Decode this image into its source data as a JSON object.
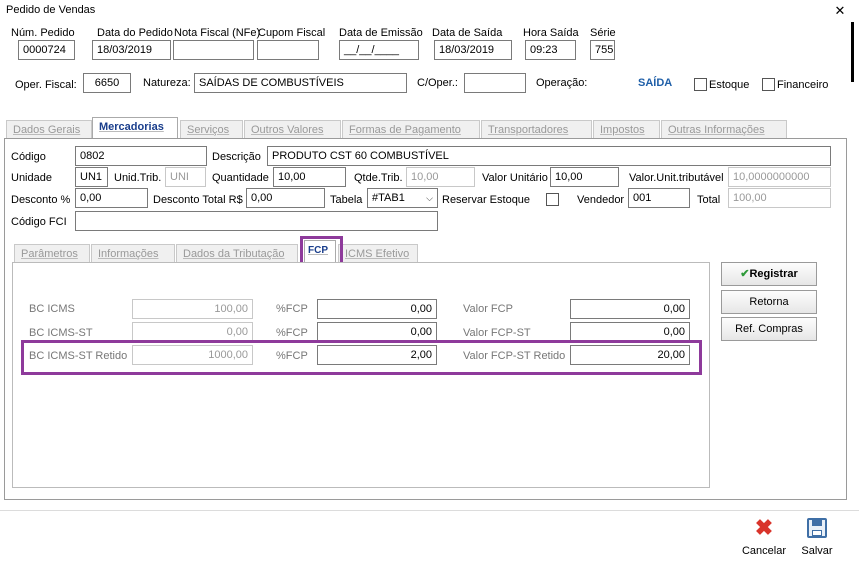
{
  "window": {
    "title": "Pedido de Vendas",
    "close_icon": "close-icon"
  },
  "header": {
    "num_pedido_label": "Núm. Pedido",
    "num_pedido": "0000724",
    "data_pedido_label": "Data do Pedido",
    "data_pedido": "18/03/2019",
    "nota_fiscal_label": "Nota Fiscal (NFe)",
    "nota_fiscal": "",
    "cupom_fiscal_label": "Cupom Fiscal",
    "cupom_fiscal": "",
    "data_emissao_label": "Data de Emissão",
    "data_emissao": "__/__/____",
    "data_saida_label": "Data de Saída",
    "data_saida": "18/03/2019",
    "hora_saida_label": "Hora Saída",
    "hora_saida": "09:23",
    "serie_label": "Série",
    "serie": "755",
    "oper_fiscal_label": "Oper. Fiscal:",
    "oper_fiscal": "6650",
    "natureza_label": "Natureza:",
    "natureza": "SAÍDAS DE COMBUSTÍVEIS",
    "c_oper_label": "C/Oper.:",
    "c_oper": "",
    "operacao_label": "Operação:",
    "operacao": "SAÍDA",
    "estoque_label": "Estoque",
    "financeiro_label": "Financeiro"
  },
  "main_tabs": [
    "Dados Gerais",
    "Mercadorias",
    "Serviços",
    "Outros Valores",
    "Formas de Pagamento",
    "Transportadores",
    "Impostos",
    "Outras Informações"
  ],
  "mercadorias": {
    "codigo_label": "Código",
    "codigo": "0802",
    "descricao_label": "Descrição",
    "descricao": "PRODUTO CST 60 COMBUSTÍVEL",
    "unidade_label": "Unidade",
    "unidade": "UN1",
    "unid_trib_label": "Unid.Trib.",
    "unid_trib": "UNI",
    "quantidade_label": "Quantidade",
    "quantidade": "10,00",
    "qtde_trib_label": "Qtde.Trib.",
    "qtde_trib": "10,00",
    "valor_unitario_label": "Valor Unitário",
    "valor_unitario": "10,00",
    "valor_unit_trib_label": "Valor.Unit.tributável",
    "valor_unit_trib": "10,0000000000",
    "desconto_pct_label": "Desconto %",
    "desconto_pct": "0,00",
    "desconto_total_label": "Desconto Total R$",
    "desconto_total": "0,00",
    "tabela_label": "Tabela",
    "tabela": "#TAB1",
    "reservar_estoque_label": "Reservar  Estoque",
    "vendedor_label": "Vendedor",
    "vendedor": "001",
    "total_label": "Total",
    "total": "100,00",
    "codigo_fci_label": "Código FCI",
    "codigo_fci": ""
  },
  "sub_tabs": [
    "Parâmetros",
    "Informações",
    "Dados da Tributação",
    "FCP",
    "ICMS Efetivo"
  ],
  "fcp": {
    "rows": [
      {
        "bc_label": "BC ICMS",
        "bc": "100,00",
        "pct_label": "%FCP",
        "pct": "0,00",
        "valor_label": "Valor FCP",
        "valor": "0,00"
      },
      {
        "bc_label": "BC ICMS-ST",
        "bc": "0,00",
        "pct_label": "%FCP",
        "pct": "0,00",
        "valor_label": "Valor FCP-ST",
        "valor": "0,00"
      },
      {
        "bc_label": "BC ICMS-ST Retido",
        "bc": "1000,00",
        "pct_label": "%FCP",
        "pct": "2,00",
        "valor_label": "Valor FCP-ST Retido",
        "valor": "20,00"
      }
    ]
  },
  "side_buttons": {
    "registrar": "Registrar",
    "retorna": "Retorna",
    "ref_compras": "Ref. Compras"
  },
  "footer": {
    "cancelar": "Cancelar",
    "salvar": "Salvar"
  },
  "colors": {
    "highlight": "#8e3a9b",
    "active_tab": "#1a3e8c",
    "saida": "#1f5fa8",
    "cancel_red": "#d9342b"
  }
}
